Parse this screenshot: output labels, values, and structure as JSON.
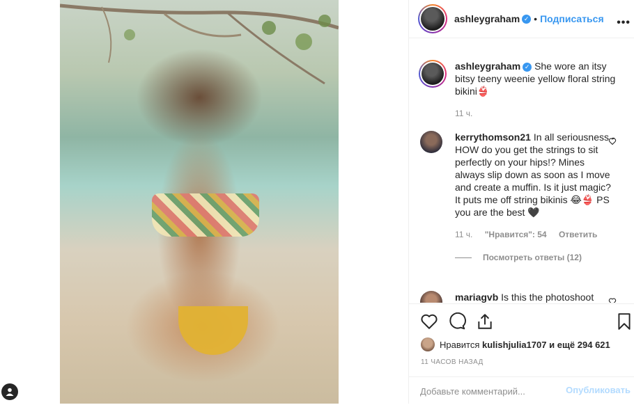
{
  "post": {
    "author": "ashleygraham",
    "follow_label": "Подписаться",
    "caption": "She wore an itsy bitsy teeny weenie yellow floral string bikini👙",
    "caption_time": "11 ч."
  },
  "comments": [
    {
      "user": "kerrythomson21",
      "text": "In all seriousness - HOW do you get the strings to sit perfectly on your hips!? Mines always slip down as soon as I move and create a muffin. Is it just magic? It puts me off string bikinis 😂👙 PS you are the best 🖤",
      "time": "11 ч.",
      "likes": "\"Нравится\": 54",
      "reply_label": "Ответить",
      "view_replies": "Посмотреть ответы (12)"
    },
    {
      "user": "mariagvb",
      "text": "Is this the photoshoot"
    }
  ],
  "actions": {
    "liked_by_prefix": "Нравится",
    "liked_by_user": "kulishjulia1707",
    "liked_by_suffix": "и ещё 294 621",
    "timestamp": "11 ЧАСОВ НАЗАД"
  },
  "add_comment": {
    "placeholder": "Добавьте комментарий...",
    "publish_label": "Опубликовать"
  },
  "colors": {
    "accent": "#3897f0",
    "publish_disabled": "#b3dbff",
    "muted": "#8e8e8e"
  }
}
